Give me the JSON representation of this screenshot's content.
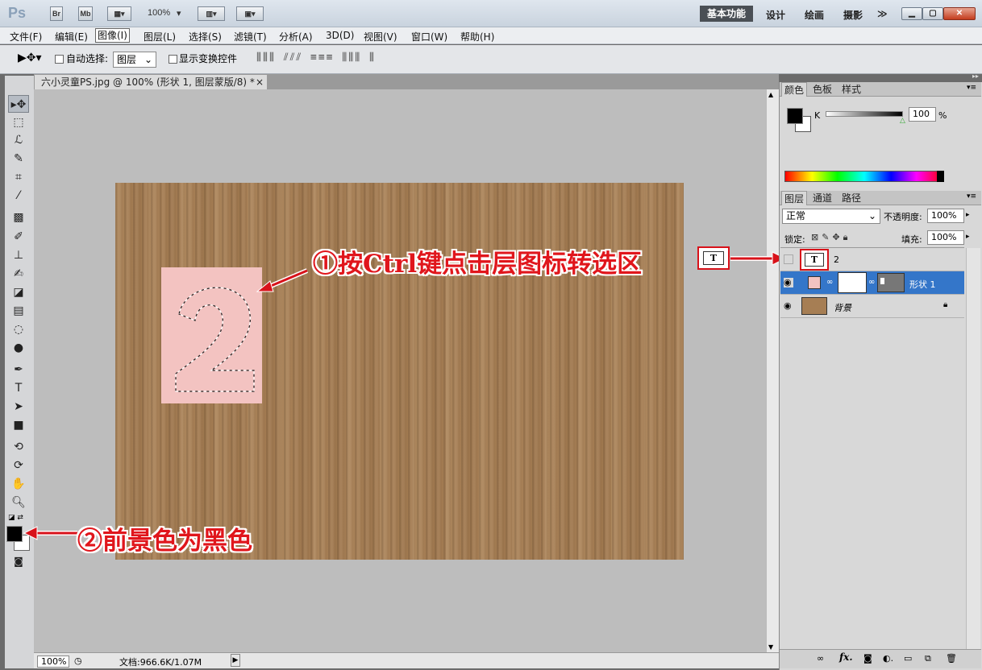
{
  "titlebar": {
    "logo": "Ps",
    "br": "Br",
    "mb": "Mb",
    "zoom": "100%",
    "workspaces": {
      "active": "基本功能",
      "items": [
        "设计",
        "绘画",
        "摄影"
      ],
      "more": "≫"
    }
  },
  "menu": [
    "文件(F)",
    "编辑(E)",
    "图像(I)",
    "图层(L)",
    "选择(S)",
    "滤镜(T)",
    "分析(A)",
    "3D(D)",
    "视图(V)",
    "窗口(W)",
    "帮助(H)"
  ],
  "menu_active_index": 2,
  "options": {
    "auto_select_label": "自动选择:",
    "auto_select_value": "图层",
    "show_transform_label": "显示变换控件"
  },
  "document": {
    "tab_title": "六小灵童PS.jpg @ 100% (形状 1, 图层蒙版/8) *",
    "close": "×"
  },
  "canvas": {
    "digit": "2",
    "texture_color": "#a67e54",
    "pink_color": "#f3c3c1"
  },
  "status": {
    "zoom": "100%",
    "doc_info": "文档:966.6K/1.07M"
  },
  "color_panel": {
    "tabs": [
      "颜色",
      "色板",
      "样式"
    ],
    "channel": "K",
    "value": "100",
    "unit": "%"
  },
  "layers_panel": {
    "tabs": [
      "图层",
      "通道",
      "路径"
    ],
    "blend_mode": "正常",
    "opacity_label": "不透明度:",
    "opacity": "100%",
    "lock_label": "锁定:",
    "fill_label": "填充:",
    "fill": "100%",
    "layers": [
      {
        "name": "2",
        "thumb": "T",
        "visible": false,
        "selected": false
      },
      {
        "name": "形状 1",
        "visible": true,
        "selected": true
      },
      {
        "name": "背景",
        "visible": true,
        "selected": false,
        "locked": true
      }
    ],
    "bottom_icons": [
      "link-icon",
      "fx-icon",
      "mask-icon",
      "adjustment-icon",
      "group-icon",
      "new-layer-icon",
      "trash-icon"
    ]
  },
  "annotations": {
    "step1": "①按Ctrl键点击层图标转选区",
    "step1_thumb": "T",
    "step2": "②前景色为黑色"
  }
}
